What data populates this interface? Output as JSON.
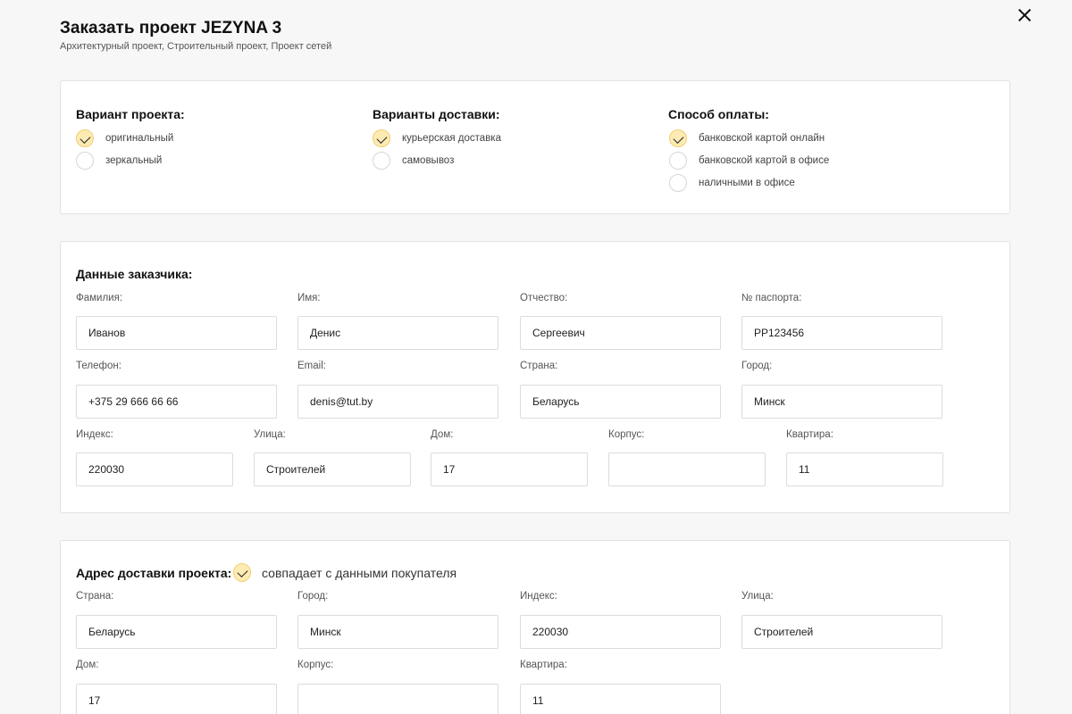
{
  "header": {
    "title": "Заказать проект JEZYNA 3",
    "subtitle": "Архитектурный проект, Строительный проект, Проект сетей"
  },
  "options": {
    "variant": {
      "title": "Вариант проекта:",
      "items": [
        {
          "label": "оригинальный",
          "checked": true
        },
        {
          "label": "зеркальный",
          "checked": false
        }
      ]
    },
    "delivery": {
      "title": "Варианты доставки:",
      "items": [
        {
          "label": "курьерская доставка",
          "checked": true
        },
        {
          "label": "самовывоз",
          "checked": false
        }
      ]
    },
    "payment": {
      "title": "Способ оплаты:",
      "items": [
        {
          "label": "банковской картой онлайн",
          "checked": true
        },
        {
          "label": "банковской картой в офисе",
          "checked": false
        },
        {
          "label": "наличными в офисе",
          "checked": false
        }
      ]
    }
  },
  "customer": {
    "title": "Данные заказчика:",
    "surname": {
      "label": "Фамилия:",
      "value": "Иванов"
    },
    "name": {
      "label": "Имя:",
      "value": "Денис"
    },
    "patronymic": {
      "label": "Отчество:",
      "value": "Сергеевич"
    },
    "passport": {
      "label": "№ паспорта:",
      "value": "PP123456"
    },
    "phone": {
      "label": "Телефон:",
      "value": "+375 29 666 66 66"
    },
    "email": {
      "label": "Email:",
      "value": "denis@tut.by"
    },
    "country": {
      "label": "Страна:",
      "value": "Беларусь"
    },
    "city": {
      "label": "Город:",
      "value": "Минск"
    },
    "zip": {
      "label": "Индекс:",
      "value": "220030"
    },
    "street": {
      "label": "Улица:",
      "value": "Строителей"
    },
    "house": {
      "label": "Дом:",
      "value": "17"
    },
    "building": {
      "label": "Корпус:",
      "value": ""
    },
    "apartment": {
      "label": "Квартира:",
      "value": "11"
    }
  },
  "delivery_address": {
    "title": "Адрес доставки проекта:",
    "same_as_buyer": {
      "label": "совпадает с данными покупателя",
      "checked": true
    },
    "country": {
      "label": "Страна:",
      "value": "Беларусь"
    },
    "city": {
      "label": "Город:",
      "value": "Минск"
    },
    "zip": {
      "label": "Индекс:",
      "value": "220030"
    },
    "street": {
      "label": "Улица:",
      "value": "Строителей"
    },
    "house": {
      "label": "Дом:",
      "value": "17"
    },
    "building": {
      "label": "Корпус:",
      "value": ""
    },
    "apartment": {
      "label": "Квартира:",
      "value": "11"
    }
  },
  "icons": {
    "close": "close-icon",
    "check": "check-icon"
  },
  "colors": {
    "check_fill": "#fdebb3",
    "check_border": "#f1cf6f"
  }
}
